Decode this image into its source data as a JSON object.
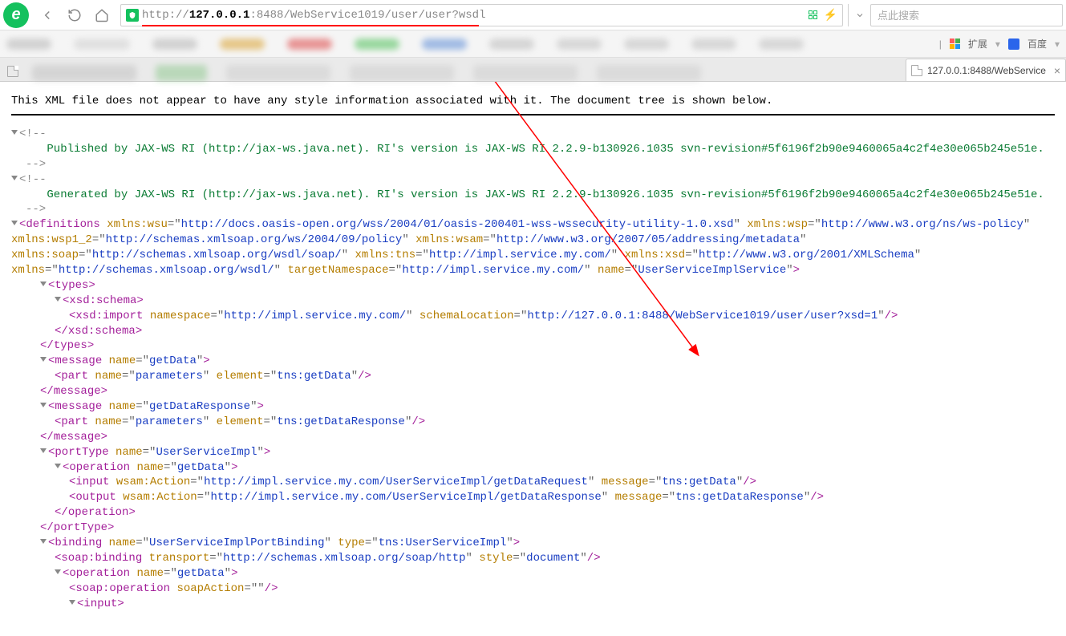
{
  "browser": {
    "url_protocol": "http://",
    "url_host": "127.0.0.1",
    "url_port_path": ":8488/WebService1019/user/user?wsdl",
    "search_placeholder": "点此搜索",
    "ext_label": "扩展",
    "baidu_label": "百度",
    "active_tab_label": "127.0.0.1:8488/WebService"
  },
  "content": {
    "notice": "This XML file does not appear to have any style information associated with it. The document tree is shown below.",
    "comment1": " Published by JAX-WS RI (http://jax-ws.java.net). RI's version is JAX-WS RI 2.2.9-b130926.1035 svn-revision#5f6196f2b90e9460065a4c2f4e30e065b245e51e. ",
    "comment2": " Generated by JAX-WS RI (http://jax-ws.java.net). RI's version is JAX-WS RI 2.2.9-b130926.1035 svn-revision#5f6196f2b90e9460065a4c2f4e30e065b245e51e. ",
    "defs_attrs": "xmlns:wsu=\"http://docs.oasis-open.org/wss/2004/01/oasis-200401-wss-wssecurity-utility-1.0.xsd\" xmlns:wsp=\"http://www.w3.org/ns/ws-policy\" xmlns:wsp1_2=\"http://schemas.xmlsoap.org/ws/2004/09/policy\" xmlns:wsam=\"http://www.w3.org/2007/05/addressing/metadata\" xmlns:soap=\"http://schemas.xmlsoap.org/wsdl/soap/\" xmlns:tns=\"http://impl.service.my.com/\" xmlns:xsd=\"http://www.w3.org/2001/XMLSchema\" xmlns=\"http://schemas.xmlsoap.org/wsdl/\" targetNamespace=\"http://impl.service.my.com/\" name=\"UserServiceImplService\"",
    "xsd_import_ns": "http://impl.service.my.com/",
    "xsd_import_loc": "http://127.0.0.1:8488/WebService1019/user/user?xsd=1",
    "msg1_name": "getData",
    "msg1_part_name": "parameters",
    "msg1_part_elem": "tns:getData",
    "msg2_name": "getDataResponse",
    "msg2_part_name": "parameters",
    "msg2_part_elem": "tns:getDataResponse",
    "porttype_name": "UserServiceImpl",
    "op_name": "getData",
    "op_in_action": "http://impl.service.my.com/UserServiceImpl/getDataRequest",
    "op_in_msg": "tns:getData",
    "op_out_action": "http://impl.service.my.com/UserServiceImpl/getDataResponse",
    "op_out_msg": "tns:getDataResponse",
    "binding_name": "UserServiceImplPortBinding",
    "binding_type": "tns:UserServiceImpl",
    "soap_transport": "http://schemas.xmlsoap.org/soap/http",
    "soap_style": "document",
    "soap_op_action": ""
  }
}
